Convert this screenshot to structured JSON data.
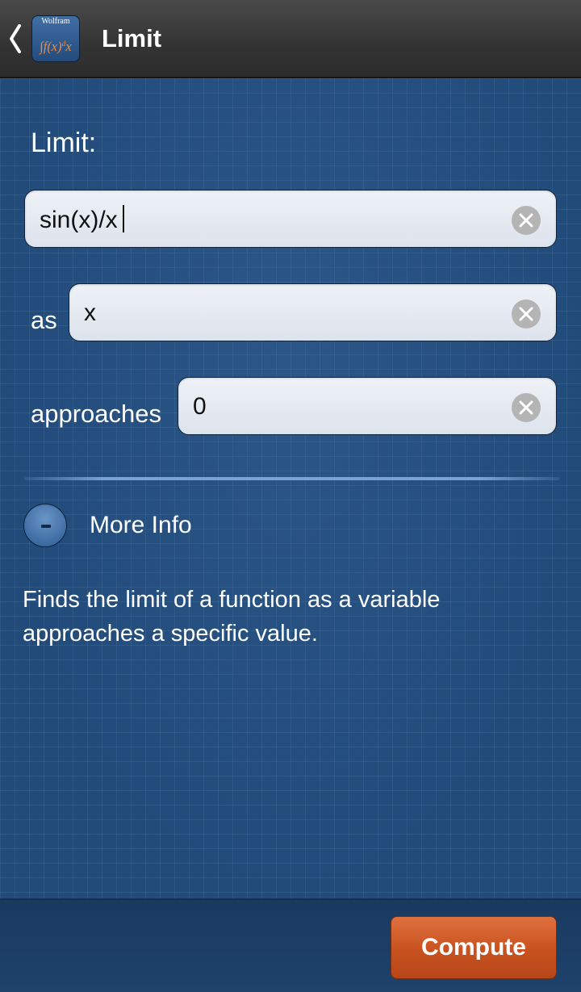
{
  "header": {
    "title": "Limit",
    "icon": {
      "brand": "Wolfram",
      "formula": "∫f(x)dx"
    }
  },
  "form": {
    "section_label": "Limit:",
    "function_field": {
      "value": "sin(x)/x"
    },
    "variable_row": {
      "label": "as",
      "value": "x"
    },
    "approaches_row": {
      "label": "approaches",
      "value": "0"
    }
  },
  "more_info": {
    "toggle_symbol": "-",
    "label": "More Info",
    "description": "Finds the limit of a function as a variable approaches a specific value."
  },
  "footer": {
    "compute_label": "Compute"
  },
  "colors": {
    "background": "#224b7a",
    "action_bar": "#3a3a3a",
    "compute_button": "#c8521f",
    "field_background": "#e6ebf2",
    "clear_icon": "#b4b4b4"
  }
}
